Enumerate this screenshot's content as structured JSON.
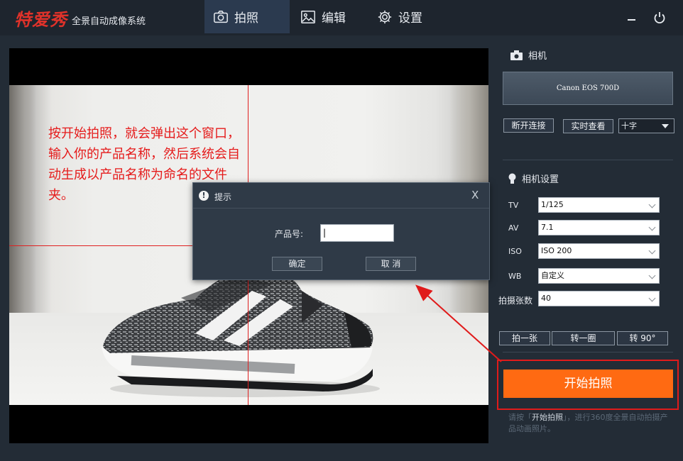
{
  "app": {
    "logo": "特爱秀",
    "subtitle": "全景自动成像系统"
  },
  "tabs": [
    {
      "label": "拍照",
      "icon": "camera-icon",
      "active": true
    },
    {
      "label": "编辑",
      "icon": "image-icon",
      "active": false
    },
    {
      "label": "设置",
      "icon": "gear-icon",
      "active": false
    }
  ],
  "window_controls": [
    "minimize-icon",
    "power-icon"
  ],
  "annotation": {
    "text": "按开始拍照，就会弹出这个窗口，输入你的产品名称，然后系统会自动生成以产品名称为命名的文件夹。"
  },
  "dialog": {
    "title": "提示",
    "close": "X",
    "field_label": "产品号:",
    "field_value": "|",
    "ok_label": "确定",
    "cancel_label": "取 消"
  },
  "camera": {
    "section_title": "相机",
    "model": "Canon EOS 700D",
    "disconnect_label": "断开连接",
    "live_view_label": "实时查看",
    "overlay_select": "十字"
  },
  "camera_settings": {
    "section_title": "相机设置",
    "tv_label": "TV",
    "tv_value": "1/125",
    "av_label": "AV",
    "av_value": "7.1",
    "iso_label": "ISO",
    "iso_value": "ISO 200",
    "wb_label": "WB",
    "wb_value": "自定义",
    "count_label": "拍摄张数",
    "count_value": "40"
  },
  "actions": {
    "shoot_one": "拍一张",
    "rotate_circle": "转一圈",
    "rotate_90": "转 90°",
    "start": "开始拍照"
  },
  "hint": {
    "prefix": "请按「",
    "emphasis": "开始拍照",
    "suffix": "」，进行360度全景自动拍摄产品动画照片。"
  },
  "colors": {
    "accent_orange": "#ff6a12",
    "annotation_red": "#e51b1b",
    "crosshair_red": "#e02020",
    "background": "#232c36"
  }
}
